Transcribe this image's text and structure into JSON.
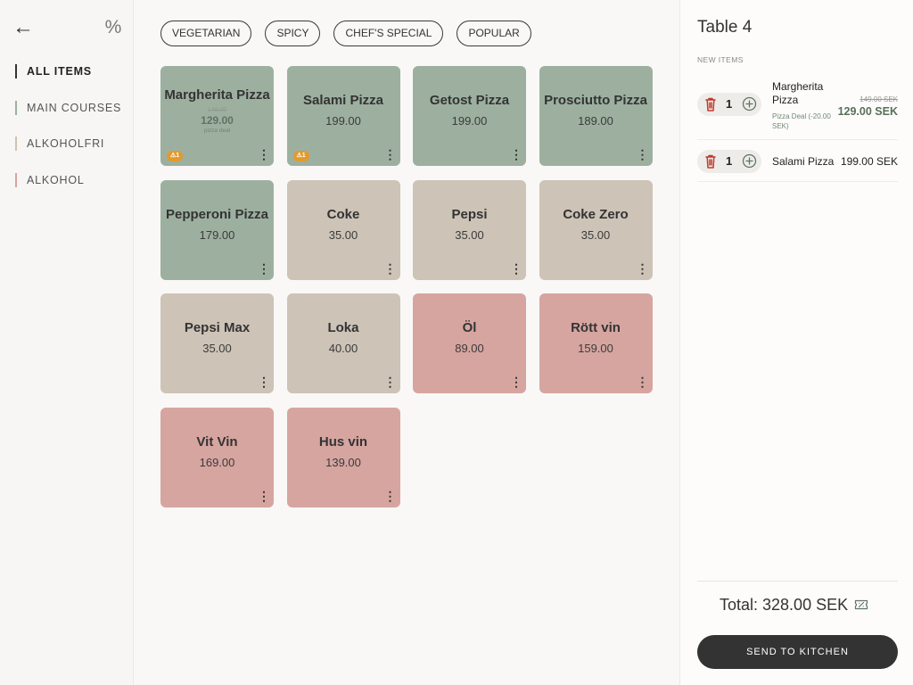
{
  "sidebar": {
    "back_icon": "←",
    "discount_icon": "%",
    "categories": [
      {
        "label": "ALL ITEMS",
        "color": "#333333",
        "active": true
      },
      {
        "label": "MAIN COURSES",
        "color": "#9db0a0",
        "active": false
      },
      {
        "label": "ALKOHOLFRI",
        "color": "#cdc3b6",
        "active": false
      },
      {
        "label": "ALKOHOL",
        "color": "#d6a5a0",
        "active": false
      }
    ]
  },
  "filters": [
    "VEGETARIAN",
    "SPICY",
    "CHEF'S SPECIAL",
    "POPULAR"
  ],
  "menu_items": [
    {
      "name": "Margherita Pizza",
      "price": "149.00",
      "deal_price": "129.00",
      "deal_label": "pizza deal",
      "color": "green",
      "warning": "⚠1"
    },
    {
      "name": "Salami Pizza",
      "price": "199.00",
      "color": "green",
      "warning": "⚠1"
    },
    {
      "name": "Getost Pizza",
      "price": "199.00",
      "color": "green"
    },
    {
      "name": "Prosciutto Pizza",
      "price": "189.00",
      "color": "green"
    },
    {
      "name": "Pepperoni Pizza",
      "price": "179.00",
      "color": "green"
    },
    {
      "name": "Coke",
      "price": "35.00",
      "color": "beige"
    },
    {
      "name": "Pepsi",
      "price": "35.00",
      "color": "beige"
    },
    {
      "name": "Coke Zero",
      "price": "35.00",
      "color": "beige"
    },
    {
      "name": "Pepsi Max",
      "price": "35.00",
      "color": "beige"
    },
    {
      "name": "Loka",
      "price": "40.00",
      "color": "beige"
    },
    {
      "name": "Öl",
      "price": "89.00",
      "color": "pink"
    },
    {
      "name": "Rött vin",
      "price": "159.00",
      "color": "pink"
    },
    {
      "name": "Vit Vin",
      "price": "169.00",
      "color": "pink"
    },
    {
      "name": "Hus vin",
      "price": "139.00",
      "color": "pink"
    }
  ],
  "order": {
    "title": "Table 4",
    "section_label": "NEW ITEMS",
    "items": [
      {
        "qty": "1",
        "name": "Margherita Pizza",
        "deal": "Pizza Deal (-20.00 SEK)",
        "old_price": "149.00 SEK",
        "price": "129.00 SEK"
      },
      {
        "qty": "1",
        "name": "Salami Pizza",
        "price": "199.00 SEK"
      }
    ],
    "total": "Total: 328.00 SEK",
    "send_label": "SEND TO KITCHEN"
  },
  "colors": {
    "green": "#9db0a0",
    "beige": "#cdc3b6",
    "pink": "#d6a5a0",
    "warning": "#e39a2c",
    "trash": "#c0392b",
    "dark": "#333333"
  }
}
